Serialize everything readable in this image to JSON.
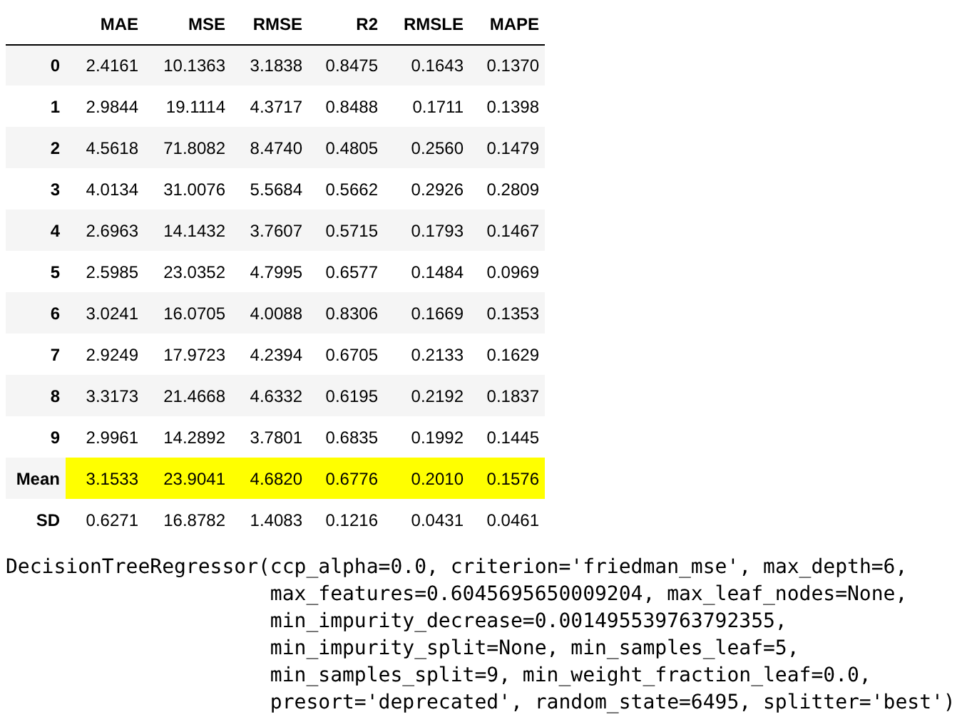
{
  "table": {
    "columns": [
      "MAE",
      "MSE",
      "RMSE",
      "R2",
      "RMSLE",
      "MAPE"
    ],
    "rows": [
      {
        "index": "0",
        "values": [
          "2.4161",
          "10.1363",
          "3.1838",
          "0.8475",
          "0.1643",
          "0.1370"
        ],
        "highlighted": false
      },
      {
        "index": "1",
        "values": [
          "2.9844",
          "19.1114",
          "4.3717",
          "0.8488",
          "0.1711",
          "0.1398"
        ],
        "highlighted": false
      },
      {
        "index": "2",
        "values": [
          "4.5618",
          "71.8082",
          "8.4740",
          "0.4805",
          "0.2560",
          "0.1479"
        ],
        "highlighted": false
      },
      {
        "index": "3",
        "values": [
          "4.0134",
          "31.0076",
          "5.5684",
          "0.5662",
          "0.2926",
          "0.2809"
        ],
        "highlighted": false
      },
      {
        "index": "4",
        "values": [
          "2.6963",
          "14.1432",
          "3.7607",
          "0.5715",
          "0.1793",
          "0.1467"
        ],
        "highlighted": false
      },
      {
        "index": "5",
        "values": [
          "2.5985",
          "23.0352",
          "4.7995",
          "0.6577",
          "0.1484",
          "0.0969"
        ],
        "highlighted": false
      },
      {
        "index": "6",
        "values": [
          "3.0241",
          "16.0705",
          "4.0088",
          "0.8306",
          "0.1669",
          "0.1353"
        ],
        "highlighted": false
      },
      {
        "index": "7",
        "values": [
          "2.9249",
          "17.9723",
          "4.2394",
          "0.6705",
          "0.2133",
          "0.1629"
        ],
        "highlighted": false
      },
      {
        "index": "8",
        "values": [
          "3.3173",
          "21.4668",
          "4.6332",
          "0.6195",
          "0.2192",
          "0.1837"
        ],
        "highlighted": false
      },
      {
        "index": "9",
        "values": [
          "2.9961",
          "14.2892",
          "3.7801",
          "0.6835",
          "0.1992",
          "0.1445"
        ],
        "highlighted": false
      },
      {
        "index": "Mean",
        "values": [
          "3.1533",
          "23.9041",
          "4.6820",
          "0.6776",
          "0.2010",
          "0.1576"
        ],
        "highlighted": true
      },
      {
        "index": "SD",
        "values": [
          "0.6271",
          "16.8782",
          "1.4083",
          "0.1216",
          "0.0431",
          "0.0461"
        ],
        "highlighted": false
      }
    ]
  },
  "output": {
    "lines": [
      "DecisionTreeRegressor(ccp_alpha=0.0, criterion='friedman_mse', max_depth=6,",
      "max_features=0.6045695650009204, max_leaf_nodes=None,",
      "min_impurity_decrease=0.001495539763792355,",
      "min_impurity_split=None, min_samples_leaf=5,",
      "min_samples_split=9, min_weight_fraction_leaf=0.0,",
      "presort='deprecated', random_state=6495, splitter='best')"
    ]
  }
}
